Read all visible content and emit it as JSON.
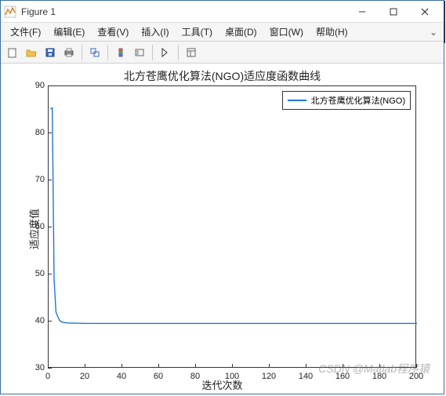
{
  "window": {
    "title": "Figure 1"
  },
  "menu": {
    "file": "文件(F)",
    "edit": "编辑(E)",
    "view": "查看(V)",
    "insert": "插入(I)",
    "tools": "工具(T)",
    "desktop": "桌面(D)",
    "window": "窗口(W)",
    "help": "帮助(H)"
  },
  "chart_data": {
    "type": "line",
    "title": "北方苍鹰优化算法(NGO)适应度函数曲线",
    "xlabel": "迭代次数",
    "ylabel": "适应度值",
    "xlim": [
      0,
      200
    ],
    "ylim": [
      30,
      90
    ],
    "xticks": [
      0,
      20,
      40,
      60,
      80,
      100,
      120,
      140,
      160,
      180,
      200
    ],
    "yticks": [
      30,
      40,
      50,
      60,
      70,
      80,
      90
    ],
    "series": [
      {
        "name": "北方苍鹰优化算法(NGO)",
        "color": "#1f77d4",
        "x": [
          1,
          2,
          3,
          4,
          5,
          6,
          7,
          8,
          10,
          20,
          40,
          60,
          80,
          100,
          120,
          140,
          160,
          180,
          200
        ],
        "y": [
          85.2,
          85.4,
          49.0,
          42.0,
          41.0,
          40.2,
          39.9,
          39.8,
          39.7,
          39.6,
          39.6,
          39.6,
          39.6,
          39.6,
          39.6,
          39.6,
          39.6,
          39.6,
          39.6
        ]
      }
    ],
    "legend_position": "upper-right"
  },
  "watermark": "CSDN @Matlab程序猿"
}
